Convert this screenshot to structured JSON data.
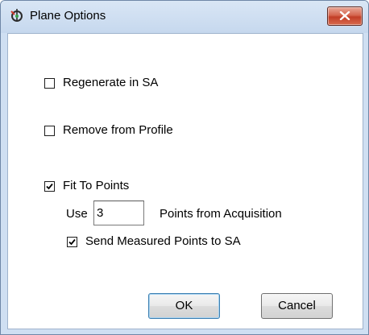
{
  "window": {
    "title": "Plane Options",
    "accent_color": "#c23e27",
    "frame_color": "#cfdff2"
  },
  "options": {
    "regenerate": {
      "label": "Regenerate in SA",
      "checked": false
    },
    "remove_profile": {
      "label": "Remove from Profile",
      "checked": false
    },
    "fit_to_points": {
      "label": "Fit To Points",
      "checked": true
    },
    "use_label": "Use",
    "points_value": "3",
    "points_suffix": "Points from Acquisition",
    "send_measured": {
      "label": "Send Measured Points to SA",
      "checked": true
    }
  },
  "buttons": {
    "ok": "OK",
    "cancel": "Cancel"
  }
}
